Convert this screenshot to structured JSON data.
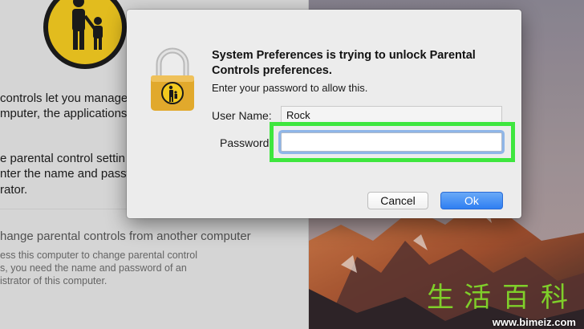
{
  "background_pane": {
    "line1": "controls let you manage",
    "line2": "mputer, the applications",
    "line3": "e parental control settin",
    "line4": "nter the name and passw",
    "line5": "rator.",
    "remote_title": "hange parental controls from another computer",
    "remote_sub1": "ess this computer to change parental control",
    "remote_sub2": "s, you need the name and password of an",
    "remote_sub3": "istrator of this computer."
  },
  "dialog": {
    "title": "System Preferences is trying to unlock Parental Controls preferences.",
    "message": "Enter your password to allow this.",
    "username_label": "User Name:",
    "username_value": "Rock",
    "password_label": "Password:",
    "password_value": "",
    "cancel_label": "Cancel",
    "ok_label": "Ok"
  },
  "watermark": {
    "chars": [
      "生",
      "活",
      "百",
      "科"
    ],
    "url": "www.bimeiz.com"
  },
  "colors": {
    "highlight": "#3ee63e",
    "ok_button": "#2f7ff2",
    "lock_gold": "#e1a92c"
  }
}
